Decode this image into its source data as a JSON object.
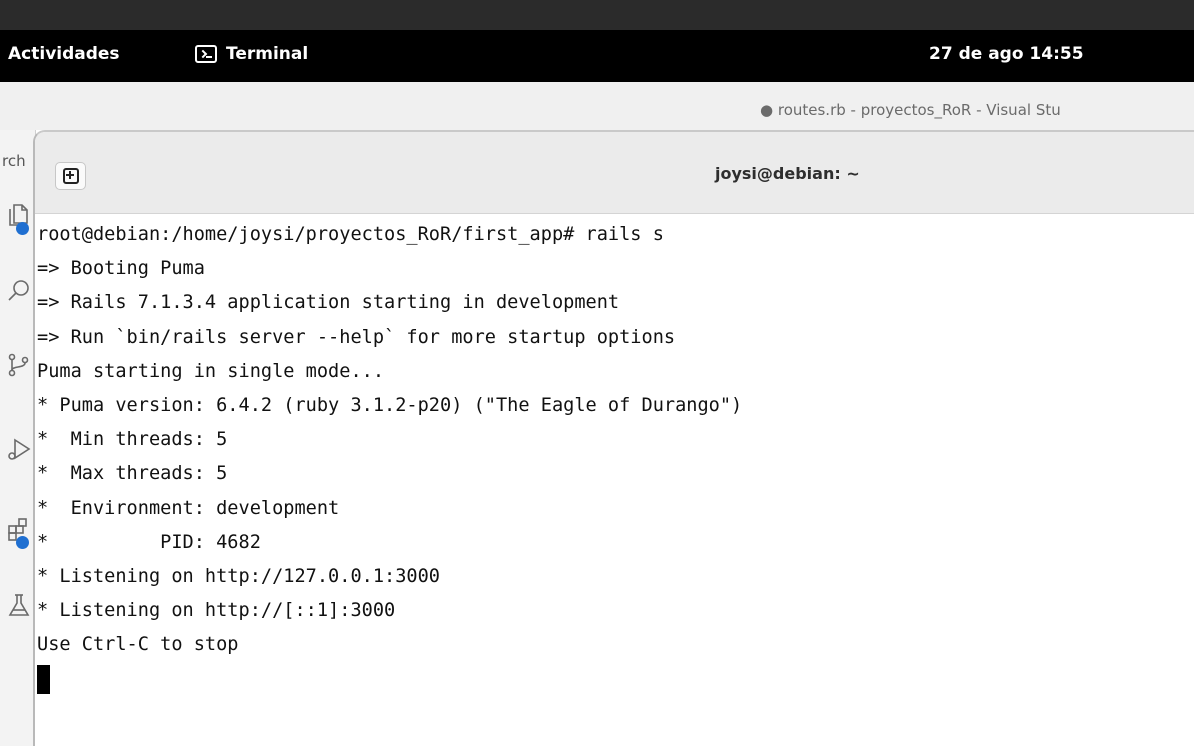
{
  "topbar": {
    "activities": "Actividades",
    "app_name": "Terminal",
    "clock": "27 de ago  14:55"
  },
  "vscode": {
    "window_title": "● routes.rb - proyectos_RoR - Visual Stu",
    "side_label": "rch"
  },
  "terminal": {
    "title": "joysi@debian: ~",
    "new_tab_icon": "plus-box-icon",
    "lines": [
      "root@debian:/home/joysi/proyectos_RoR/first_app# rails s",
      "=> Booting Puma",
      "=> Rails 7.1.3.4 application starting in development",
      "=> Run `bin/rails server --help` for more startup options",
      "Puma starting in single mode...",
      "* Puma version: 6.4.2 (ruby 3.1.2-p20) (\"The Eagle of Durango\")",
      "*  Min threads: 5",
      "*  Max threads: 5",
      "*  Environment: development",
      "*          PID: 4682",
      "* Listening on http://127.0.0.1:3000",
      "* Listening on http://[::1]:3000",
      "Use Ctrl-C to stop"
    ]
  },
  "colors": {
    "topbar_bg": "#000000",
    "badge_blue": "#1f6fd1",
    "terminal_text": "#111111"
  },
  "icons": [
    "explorer-icon",
    "search-icon",
    "source-control-icon",
    "run-debug-icon",
    "extensions-icon",
    "testing-icon"
  ]
}
